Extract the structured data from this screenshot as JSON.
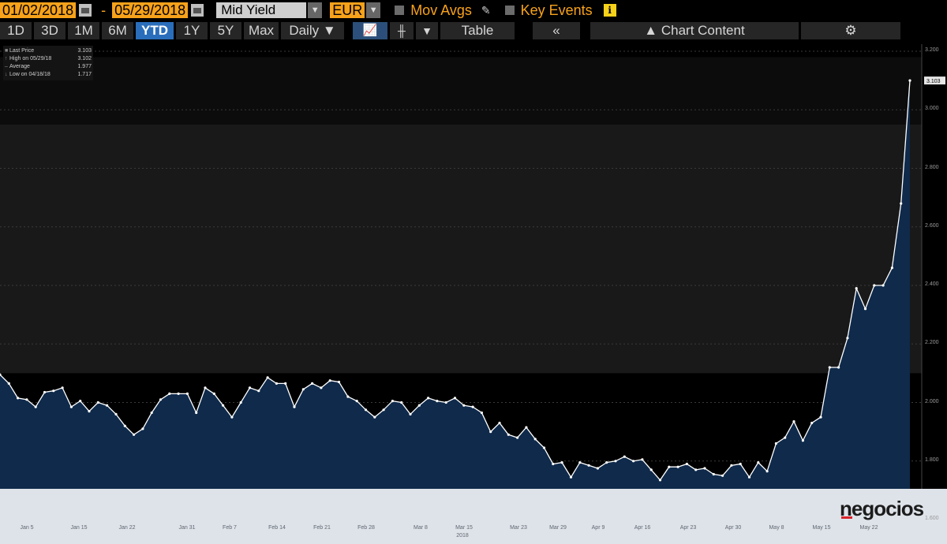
{
  "toolbar": {
    "start_date": "01/02/2018",
    "end_date": "05/29/2018",
    "dash": "-",
    "field": "Mid Yield",
    "currency": "EUR",
    "mov_avgs": "Mov Avgs",
    "key_events": "Key Events",
    "info_glyph": "i",
    "periods": [
      "1D",
      "3D",
      "1M",
      "6M",
      "YTD",
      "1Y",
      "5Y",
      "Max"
    ],
    "active_period": "YTD",
    "frequency": "Daily",
    "table": "Table",
    "chart_content": "Chart Content",
    "accent_color": "#f7a21a",
    "active_color": "#2a6ebb"
  },
  "legend": {
    "rows": [
      {
        "name": "Last Price",
        "value": "3.103"
      },
      {
        "name": "High on 05/29/18",
        "value": "3.102"
      },
      {
        "name": "Average",
        "value": "1.977"
      },
      {
        "name": "Low on 04/18/18",
        "value": "1.717"
      }
    ]
  },
  "watermark": "negocios",
  "chart_data": {
    "type": "area",
    "title": "",
    "xlabel": "",
    "ylabel": "",
    "year_label": "2018",
    "last_value_label": "3.103",
    "ylim": [
      1.6,
      3.2
    ],
    "yticks": [
      "3.200",
      "3.000",
      "2.800",
      "2.600",
      "2.400",
      "2.200",
      "2.000",
      "1.800",
      "1.600"
    ],
    "xtick_labels": [
      "Jan 5",
      "Jan 15",
      "Jan 22",
      "Jan 31",
      "Feb 7",
      "Feb 14",
      "Feb 21",
      "Feb 28",
      "Mar 8",
      "Mar 15",
      "Mar 23",
      "Mar 29",
      "Apr 9",
      "Apr 16",
      "Apr 23",
      "Apr 30",
      "May 8",
      "May 15",
      "May 22"
    ],
    "series": [
      {
        "values": [
          2.095,
          2.065,
          2.015,
          2.01,
          1.985,
          2.035,
          2.04,
          2.05,
          1.985,
          2.005,
          1.97,
          2.0,
          1.99,
          1.96,
          1.92,
          1.89,
          1.91,
          1.965,
          2.01,
          2.03,
          2.03,
          2.03,
          1.965,
          2.05,
          2.03,
          1.99,
          1.95,
          2.0,
          2.05,
          2.04,
          2.085,
          2.065,
          2.065,
          1.985,
          2.045,
          2.065,
          2.05,
          2.075,
          2.07,
          2.02,
          2.005,
          1.975,
          1.95,
          1.975,
          2.005,
          2.0,
          1.96,
          1.99,
          2.015,
          2.005,
          2.0,
          2.015,
          1.99,
          1.985,
          1.965,
          1.9,
          1.93,
          1.89,
          1.88,
          1.915,
          1.875,
          1.845,
          1.79,
          1.795,
          1.745,
          1.795,
          1.785,
          1.775,
          1.795,
          1.8,
          1.815,
          1.8,
          1.805,
          1.77,
          1.735,
          1.78,
          1.78,
          1.79,
          1.77,
          1.775,
          1.755,
          1.75,
          1.785,
          1.79,
          1.745,
          1.795,
          1.765,
          1.86,
          1.88,
          1.935,
          1.87,
          1.93,
          1.95,
          2.12,
          2.12,
          2.22,
          2.39,
          2.32,
          2.4,
          2.4,
          2.46,
          2.68,
          3.1
        ]
      }
    ],
    "line_color": "#ffffff",
    "fill_color": "#0f2a4b",
    "band_color": "#191919",
    "background": "#000000"
  }
}
